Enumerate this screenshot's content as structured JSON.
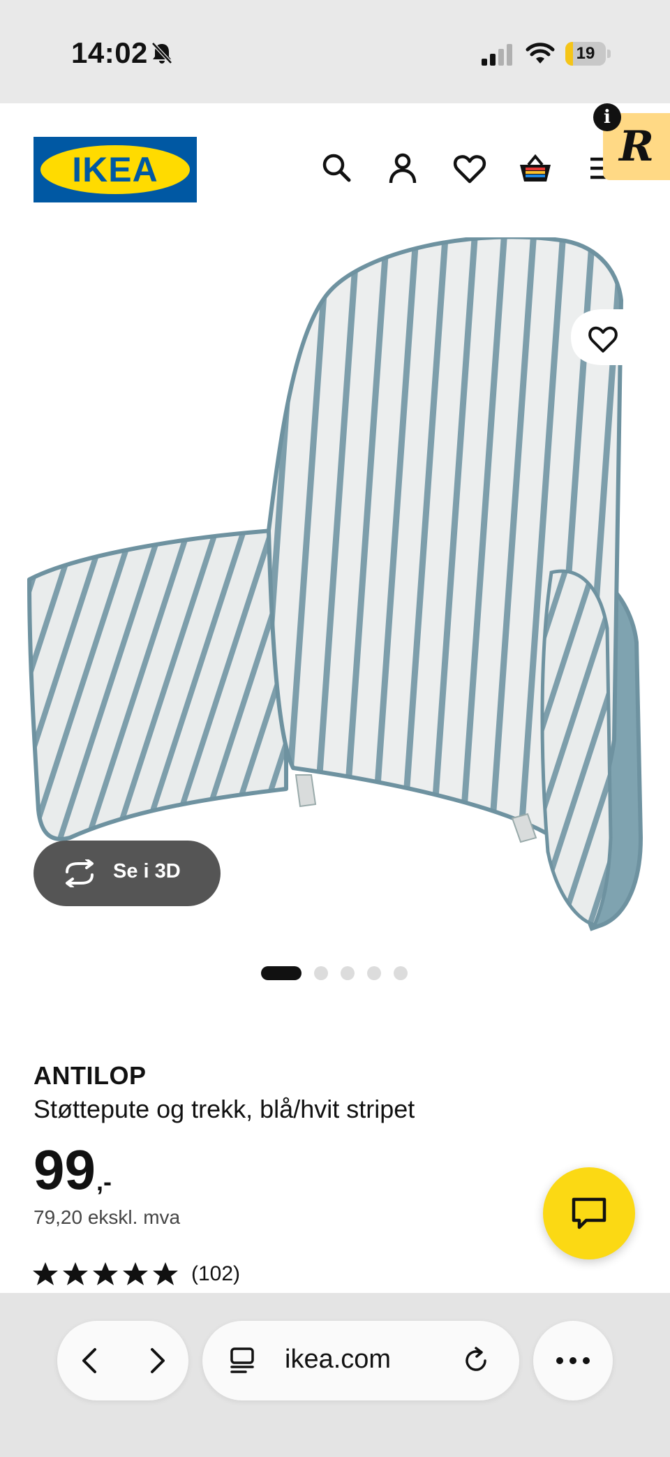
{
  "status_bar": {
    "time": "14:02",
    "battery_level": "19",
    "battery_fraction": 0.19,
    "icons": [
      "bell-off-icon",
      "cellular-signal-icon",
      "wifi-icon",
      "battery-icon"
    ]
  },
  "header": {
    "logo_text": "IKEA",
    "icons": [
      "search-icon",
      "account-icon",
      "heart-icon",
      "basket-icon",
      "menu-icon"
    ],
    "extension_badge_letter": "R",
    "info_letter": "i"
  },
  "product": {
    "name": "ANTILOP",
    "description": "Støttepute og trekk, blå/hvit stripet",
    "price": "99",
    "price_suffix": ",-",
    "price_excl_vat": "79,20 ekskl. mva",
    "rating_stars": 5,
    "review_count": "(102)",
    "view_3d_label": "Se i 3D",
    "image_count": 5,
    "active_image_index": 0
  },
  "browser": {
    "url": "ikea.com",
    "buttons": [
      "back-icon",
      "forward-icon",
      "reader-icon",
      "reload-icon",
      "more-icon"
    ]
  },
  "colors": {
    "ikea_blue": "#0058a3",
    "ikea_yellow": "#ffdb00",
    "chat_fab": "#fbd914",
    "stripe": "#7d9eab",
    "cushion_side": "#7fa3b0"
  }
}
